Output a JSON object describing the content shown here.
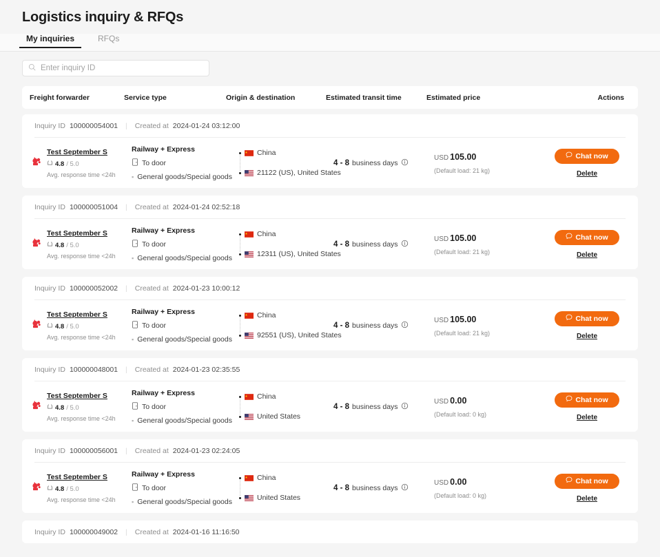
{
  "header": {
    "title": "Logistics inquiry & RFQs"
  },
  "tabs": [
    {
      "label": "My inquiries",
      "active": true
    },
    {
      "label": "RFQs",
      "active": false
    }
  ],
  "search": {
    "placeholder": "Enter inquiry ID",
    "value": "",
    "icon": "search-icon"
  },
  "table_headers": {
    "freight_forwarder": "Freight forwarder",
    "service_type": "Service type",
    "origin_destination": "Origin & destination",
    "estimated_transit_time": "Estimated transit time",
    "estimated_price": "Estimated price",
    "actions": "Actions"
  },
  "labels": {
    "inquiry_id": "Inquiry ID",
    "created_at": "Created at",
    "chat_now": "Chat now",
    "delete": "Delete",
    "rating_suffix": "/ 5.0",
    "response_time": "Avg. response time <24h"
  },
  "colors": {
    "accent_orange": "#f26a0f",
    "page_bg": "#f5f5f5",
    "card_bg": "#ffffff",
    "text_primary": "#1c1c1c",
    "text_muted": "#8d8d8d"
  },
  "rows": [
    {
      "inquiry_id": "100000054001",
      "created_at": "2024-01-24 03:12:00",
      "forwarder": {
        "name": "Test  September S",
        "rating": "4.8",
        "rating_scale": "/ 5.0",
        "response_time": "Avg. response time <24h"
      },
      "service": {
        "title": "Railway + Express",
        "delivery": "To door",
        "goods": "General goods/Special goods"
      },
      "origin": "China",
      "destination": "21122 (US), United States",
      "transit_range": "4 - 8",
      "transit_unit": "business days",
      "price_currency": "USD",
      "price_amount": "105.00",
      "price_note": "(Default load: 21 kg)",
      "chat_label": "Chat now",
      "delete_label": "Delete"
    },
    {
      "inquiry_id": "100000051004",
      "created_at": "2024-01-24 02:52:18",
      "forwarder": {
        "name": "Test  September S",
        "rating": "4.8",
        "rating_scale": "/ 5.0",
        "response_time": "Avg. response time <24h"
      },
      "service": {
        "title": "Railway + Express",
        "delivery": "To door",
        "goods": "General goods/Special goods"
      },
      "origin": "China",
      "destination": "12311 (US), United States",
      "transit_range": "4 - 8",
      "transit_unit": "business days",
      "price_currency": "USD",
      "price_amount": "105.00",
      "price_note": "(Default load: 21 kg)",
      "chat_label": "Chat now",
      "delete_label": "Delete"
    },
    {
      "inquiry_id": "100000052002",
      "created_at": "2024-01-23 10:00:12",
      "forwarder": {
        "name": "Test  September S",
        "rating": "4.8",
        "rating_scale": "/ 5.0",
        "response_time": "Avg. response time <24h"
      },
      "service": {
        "title": "Railway + Express",
        "delivery": "To door",
        "goods": "General goods/Special goods"
      },
      "origin": "China",
      "destination": "92551 (US), United States",
      "transit_range": "4 - 8",
      "transit_unit": "business days",
      "price_currency": "USD",
      "price_amount": "105.00",
      "price_note": "(Default load: 21 kg)",
      "chat_label": "Chat now",
      "delete_label": "Delete"
    },
    {
      "inquiry_id": "100000048001",
      "created_at": "2024-01-23 02:35:55",
      "forwarder": {
        "name": "Test  September S",
        "rating": "4.8",
        "rating_scale": "/ 5.0",
        "response_time": "Avg. response time <24h"
      },
      "service": {
        "title": "Railway + Express",
        "delivery": "To door",
        "goods": "General goods/Special goods"
      },
      "origin": "China",
      "destination": "United States",
      "transit_range": "4 - 8",
      "transit_unit": "business days",
      "price_currency": "USD",
      "price_amount": "0.00",
      "price_note": "(Default load: 0 kg)",
      "chat_label": "Chat now",
      "delete_label": "Delete"
    },
    {
      "inquiry_id": "100000056001",
      "created_at": "2024-01-23 02:24:05",
      "forwarder": {
        "name": "Test  September S",
        "rating": "4.8",
        "rating_scale": "/ 5.0",
        "response_time": "Avg. response time <24h"
      },
      "service": {
        "title": "Railway + Express",
        "delivery": "To door",
        "goods": "General goods/Special goods"
      },
      "origin": "China",
      "destination": "United States",
      "transit_range": "4 - 8",
      "transit_unit": "business days",
      "price_currency": "USD",
      "price_amount": "0.00",
      "price_note": "(Default load: 0 kg)",
      "chat_label": "Chat now",
      "delete_label": "Delete"
    },
    {
      "inquiry_id": "100000049002",
      "created_at": "2024-01-16 11:16:50",
      "partial": true
    }
  ]
}
